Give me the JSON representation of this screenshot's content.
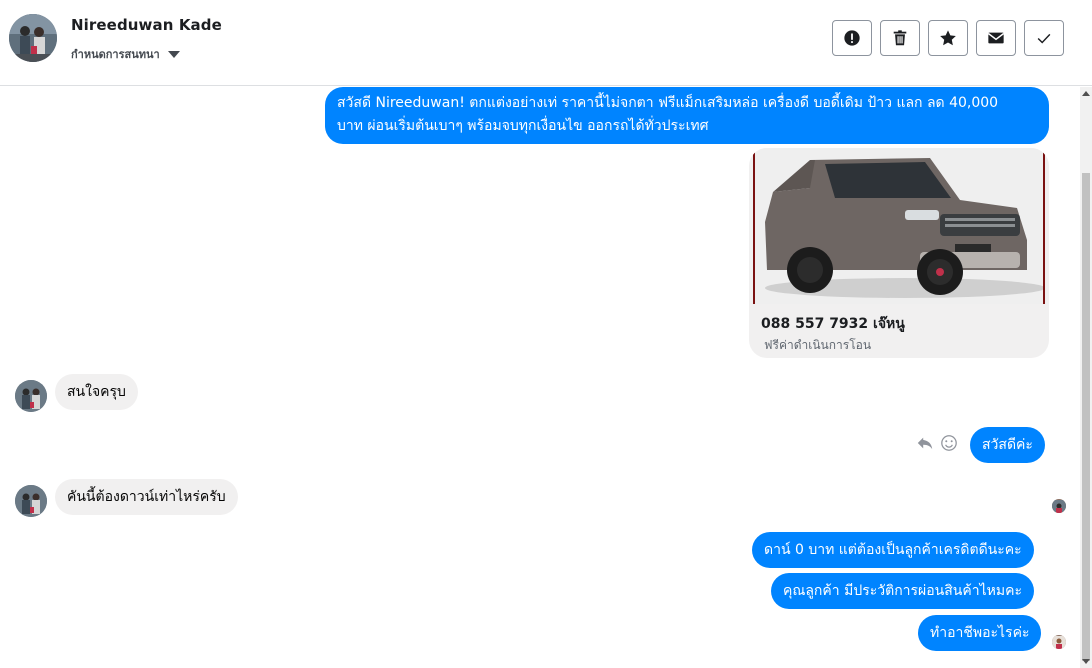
{
  "header": {
    "contact_name": "Nireeduwan Kade",
    "subtitle": "กำหนดการสนทนา"
  },
  "toolbar": {
    "buttons": [
      "report-spam",
      "delete",
      "star",
      "mark-unread",
      "done"
    ]
  },
  "messages": {
    "m1": "สวัสดี Nireeduwan! ตกแต่งอย่างเท่ ราคานี้ไม่จกตา ฟรีแม็กเสริมหล่อ เครื่องดี บอดี้เดิม ป้าว แลก ลด 40,000",
    "m1_line2": "บาท ผ่อนเริ่มต้นเบาๆ พร้อมจบทุกเงื่อนไข ออกรถได้ทั่วประเทศ",
    "card_title": "088 557 7932 เจ๊หนู",
    "card_sub": "ฟรีค่าดำเนินการโอน",
    "m2": "สนใจครุบ",
    "m3": "สวัสดีค่ะ",
    "m4": "คันนี้ต้องดาวน์เท่าไหร่ครับ",
    "m5": "ดาน์ 0 บาท แต่ต้องเป็นลูกค้าเครดิตดีนะคะ",
    "m6": "คุณลูกค้า มีประวัติการผ่อนสินค้าไหมคะ",
    "m7": "ทำอาชีพอะไรค่ะ"
  },
  "colors": {
    "outgoing": "#0084ff",
    "incoming": "#f1f0f0",
    "card_border": "#7a1212"
  },
  "icons": {
    "reply": "reply-icon",
    "emoji": "smiley-icon"
  }
}
